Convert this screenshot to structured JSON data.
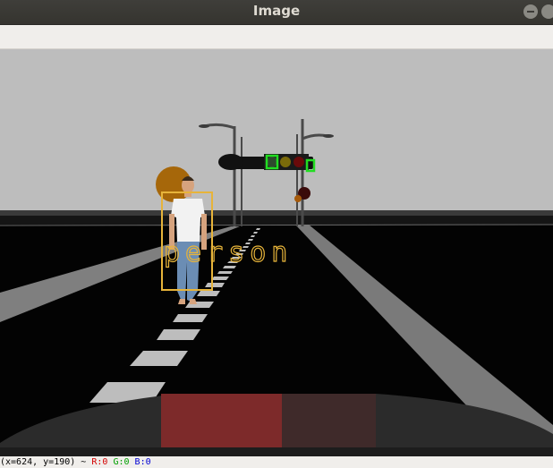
{
  "window": {
    "title": "Image"
  },
  "detection": {
    "label": "person",
    "box_color": "#e7b43a"
  },
  "traffic_light_markers_color": "#22dd22",
  "status": {
    "coords": "(x=624, y=190) ~",
    "r": "R:0",
    "g": "G:0",
    "b": "B:0",
    "colors": {
      "r": "#d40000",
      "g": "#00a000",
      "b": "#0000d4"
    }
  }
}
